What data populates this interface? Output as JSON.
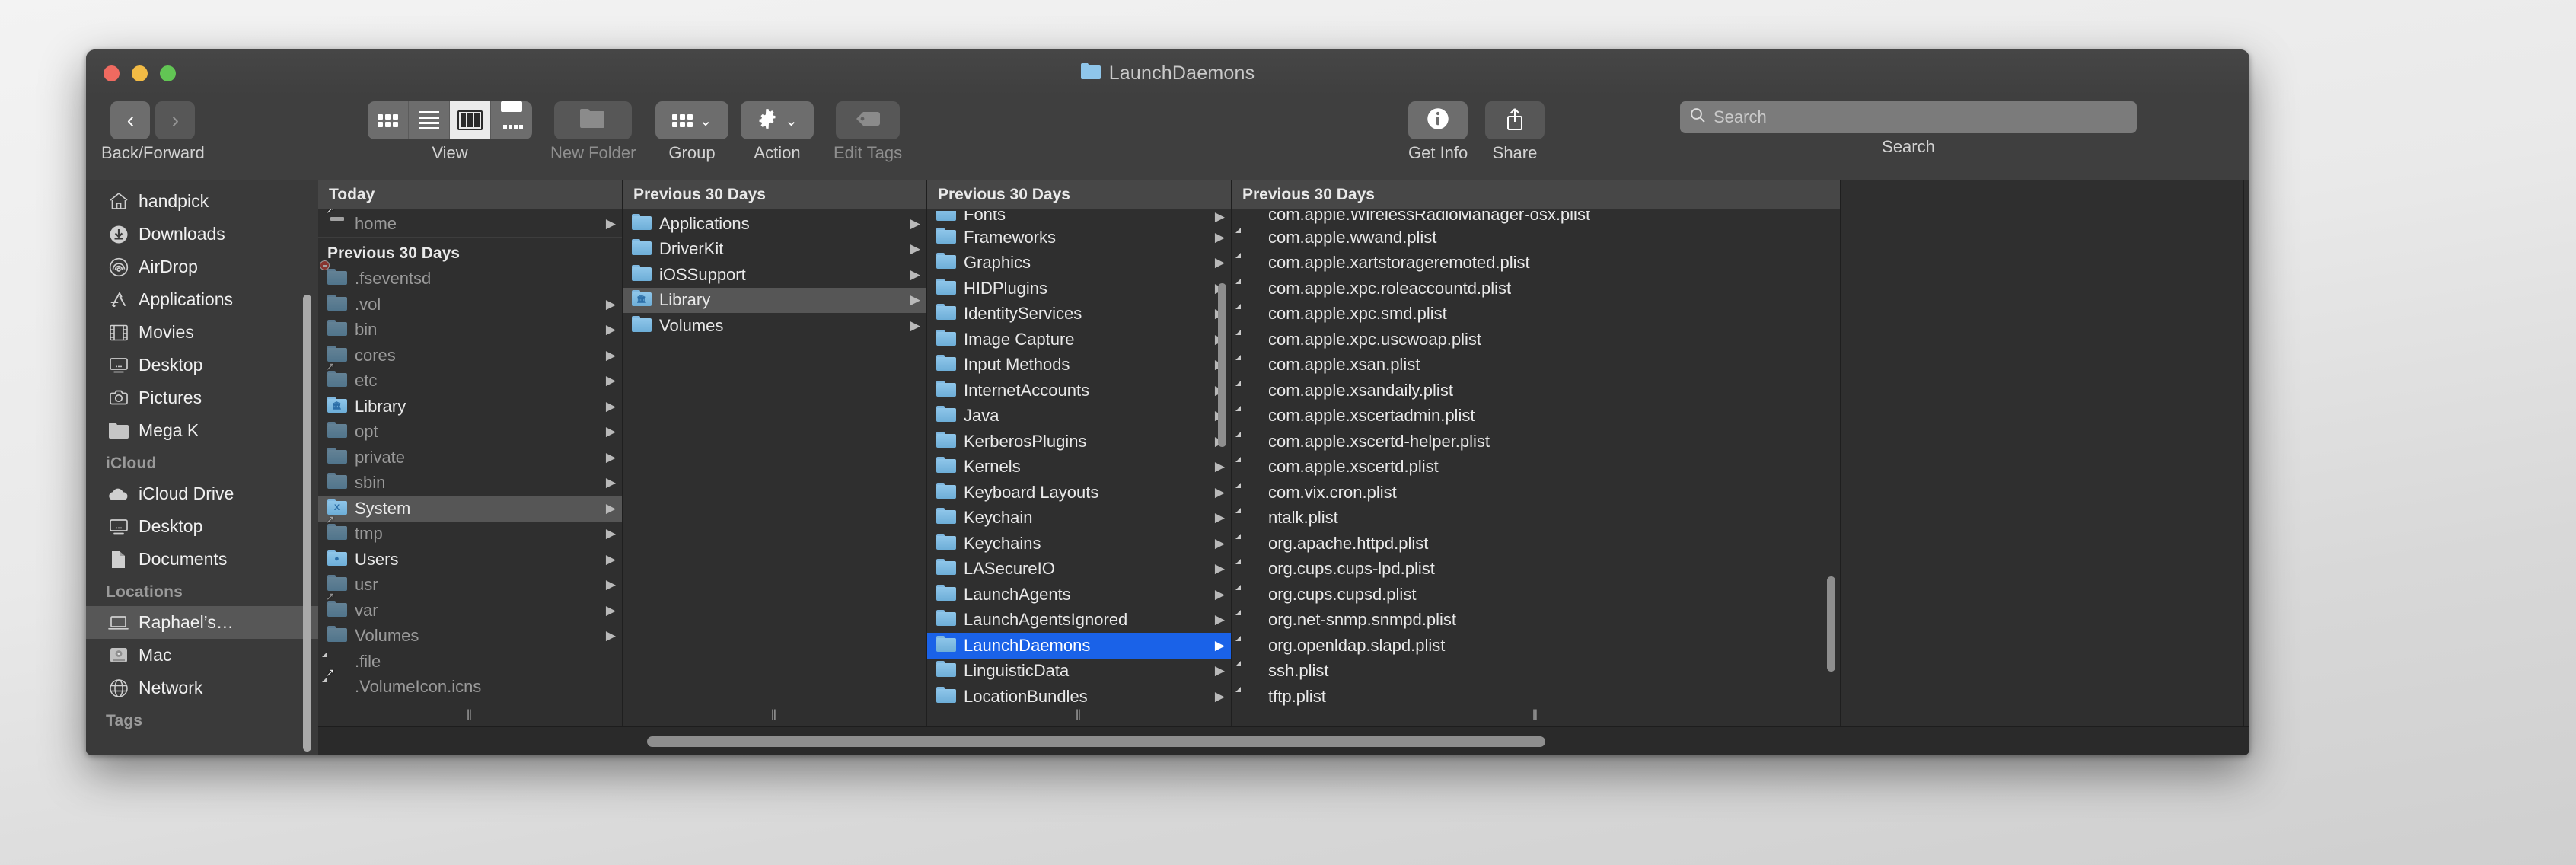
{
  "window": {
    "title": "LaunchDaemons",
    "traffic_lights": [
      "close",
      "minimize",
      "zoom"
    ]
  },
  "toolbar": {
    "nav": {
      "label": "Back/Forward",
      "back": "‹",
      "forward": "›"
    },
    "view": {
      "label": "View",
      "options": [
        "icon",
        "list",
        "column",
        "gallery"
      ],
      "selected": "column"
    },
    "new_folder": {
      "label": "New Folder"
    },
    "group": {
      "label": "Group"
    },
    "action": {
      "label": "Action"
    },
    "edit_tags": {
      "label": "Edit Tags"
    },
    "get_info": {
      "label": "Get Info"
    },
    "share": {
      "label": "Share"
    },
    "search": {
      "label": "Search",
      "placeholder": "Search",
      "value": ""
    }
  },
  "sidebar": {
    "sections": [
      {
        "heading": "",
        "items": [
          {
            "label": "handpick",
            "icon": "home-icon"
          },
          {
            "label": "Downloads",
            "icon": "downloads-icon"
          },
          {
            "label": "AirDrop",
            "icon": "airdrop-icon"
          },
          {
            "label": "Applications",
            "icon": "applications-icon"
          },
          {
            "label": "Movies",
            "icon": "movies-icon"
          },
          {
            "label": "Desktop",
            "icon": "desktop-icon"
          },
          {
            "label": "Pictures",
            "icon": "pictures-icon"
          },
          {
            "label": "Mega K",
            "icon": "folder-icon"
          }
        ]
      },
      {
        "heading": "iCloud",
        "items": [
          {
            "label": "iCloud Drive",
            "icon": "cloud-icon"
          },
          {
            "label": "Desktop",
            "icon": "desktop-icon"
          },
          {
            "label": "Documents",
            "icon": "documents-icon"
          }
        ]
      },
      {
        "heading": "Locations",
        "items": [
          {
            "label": "Raphael’s…",
            "icon": "laptop-icon",
            "selected": true
          },
          {
            "label": "Mac",
            "icon": "harddisk-icon"
          },
          {
            "label": "Network",
            "icon": "network-icon"
          }
        ]
      },
      {
        "heading": "Tags",
        "items": []
      }
    ]
  },
  "columns": [
    {
      "header": "Today",
      "groups": [
        {
          "label": "",
          "rows": [
            {
              "name": "home",
              "icon": "network-drive-icon",
              "arrow": true,
              "dim": true,
              "alias": true
            }
          ]
        },
        {
          "label": "Previous 30 Days",
          "rows": [
            {
              "name": ".fseventsd",
              "icon": "folder-icon",
              "arrow": false,
              "dim": true,
              "stop": true
            },
            {
              "name": ".vol",
              "icon": "folder-icon",
              "arrow": true,
              "dim": true
            },
            {
              "name": "bin",
              "icon": "folder-icon",
              "arrow": true,
              "dim": true
            },
            {
              "name": "cores",
              "icon": "folder-icon",
              "arrow": true,
              "dim": true
            },
            {
              "name": "etc",
              "icon": "folder-icon",
              "arrow": true,
              "dim": true,
              "alias": true
            },
            {
              "name": "Library",
              "icon": "library-folder-icon",
              "arrow": true,
              "dim": false
            },
            {
              "name": "opt",
              "icon": "folder-icon",
              "arrow": true,
              "dim": true
            },
            {
              "name": "private",
              "icon": "folder-icon",
              "arrow": true,
              "dim": true
            },
            {
              "name": "sbin",
              "icon": "folder-icon",
              "arrow": true,
              "dim": true
            },
            {
              "name": "System",
              "icon": "system-folder-icon",
              "arrow": true,
              "dim": false,
              "selected": "inactive"
            },
            {
              "name": "tmp",
              "icon": "folder-icon",
              "arrow": true,
              "dim": true,
              "alias": true
            },
            {
              "name": "Users",
              "icon": "users-folder-icon",
              "arrow": true,
              "dim": false
            },
            {
              "name": "usr",
              "icon": "folder-icon",
              "arrow": true,
              "dim": true
            },
            {
              "name": "var",
              "icon": "folder-icon",
              "arrow": true,
              "dim": true,
              "alias": true
            },
            {
              "name": "Volumes",
              "icon": "folder-icon",
              "arrow": true,
              "dim": true
            },
            {
              "name": ".file",
              "icon": "document-icon",
              "arrow": false,
              "dim": true
            },
            {
              "name": ".VolumeIcon.icns",
              "icon": "document-icon",
              "arrow": false,
              "dim": true,
              "alias": true
            }
          ]
        }
      ]
    },
    {
      "header": "Previous 30 Days",
      "groups": [
        {
          "label": "",
          "rows": [
            {
              "name": "Applications",
              "icon": "folder-icon",
              "arrow": true
            },
            {
              "name": "DriverKit",
              "icon": "folder-icon",
              "arrow": true
            },
            {
              "name": "iOSSupport",
              "icon": "folder-icon",
              "arrow": true
            },
            {
              "name": "Library",
              "icon": "library-folder-icon",
              "arrow": true,
              "selected": "inactive"
            },
            {
              "name": "Volumes",
              "icon": "folder-icon",
              "arrow": true
            }
          ]
        }
      ]
    },
    {
      "header": "Previous 30 Days",
      "groups": [
        {
          "label": "",
          "rows": [
            {
              "name": "Fonts",
              "icon": "folder-icon",
              "arrow": true,
              "clipped": true
            },
            {
              "name": "Frameworks",
              "icon": "folder-icon",
              "arrow": true
            },
            {
              "name": "Graphics",
              "icon": "folder-icon",
              "arrow": true
            },
            {
              "name": "HIDPlugins",
              "icon": "folder-icon",
              "arrow": true
            },
            {
              "name": "IdentityServices",
              "icon": "folder-icon",
              "arrow": true
            },
            {
              "name": "Image Capture",
              "icon": "folder-icon",
              "arrow": true
            },
            {
              "name": "Input Methods",
              "icon": "folder-icon",
              "arrow": true
            },
            {
              "name": "InternetAccounts",
              "icon": "folder-icon",
              "arrow": true
            },
            {
              "name": "Java",
              "icon": "folder-icon",
              "arrow": true
            },
            {
              "name": "KerberosPlugins",
              "icon": "folder-icon",
              "arrow": true
            },
            {
              "name": "Kernels",
              "icon": "folder-icon",
              "arrow": true
            },
            {
              "name": "Keyboard Layouts",
              "icon": "folder-icon",
              "arrow": true
            },
            {
              "name": "Keychain",
              "icon": "folder-icon",
              "arrow": true
            },
            {
              "name": "Keychains",
              "icon": "folder-icon",
              "arrow": true
            },
            {
              "name": "LASecureIO",
              "icon": "folder-icon",
              "arrow": true
            },
            {
              "name": "LaunchAgents",
              "icon": "folder-icon",
              "arrow": true
            },
            {
              "name": "LaunchAgentsIgnored",
              "icon": "folder-icon",
              "arrow": true
            },
            {
              "name": "LaunchDaemons",
              "icon": "folder-icon",
              "arrow": true,
              "selected": "active"
            },
            {
              "name": "LinguisticData",
              "icon": "folder-icon",
              "arrow": true
            },
            {
              "name": "LocationBundles",
              "icon": "folder-icon",
              "arrow": true
            }
          ]
        }
      ]
    },
    {
      "header": "Previous 30 Days",
      "groups": [
        {
          "label": "",
          "rows": [
            {
              "name": "com.apple.WirelessRadioManager-osx.plist",
              "icon": "document-icon",
              "clipped": true
            },
            {
              "name": "com.apple.wwand.plist",
              "icon": "document-icon"
            },
            {
              "name": "com.apple.xartstorageremoted.plist",
              "icon": "document-icon"
            },
            {
              "name": "com.apple.xpc.roleaccountd.plist",
              "icon": "document-icon"
            },
            {
              "name": "com.apple.xpc.smd.plist",
              "icon": "document-icon"
            },
            {
              "name": "com.apple.xpc.uscwoap.plist",
              "icon": "document-icon"
            },
            {
              "name": "com.apple.xsan.plist",
              "icon": "document-icon"
            },
            {
              "name": "com.apple.xsandaily.plist",
              "icon": "document-icon"
            },
            {
              "name": "com.apple.xscertadmin.plist",
              "icon": "document-icon"
            },
            {
              "name": "com.apple.xscertd-helper.plist",
              "icon": "document-icon"
            },
            {
              "name": "com.apple.xscertd.plist",
              "icon": "document-icon"
            },
            {
              "name": "com.vix.cron.plist",
              "icon": "document-icon"
            },
            {
              "name": "ntalk.plist",
              "icon": "document-icon"
            },
            {
              "name": "org.apache.httpd.plist",
              "icon": "document-icon"
            },
            {
              "name": "org.cups.cups-lpd.plist",
              "icon": "document-icon"
            },
            {
              "name": "org.cups.cupsd.plist",
              "icon": "document-icon"
            },
            {
              "name": "org.net-snmp.snmpd.plist",
              "icon": "document-icon"
            },
            {
              "name": "org.openldap.slapd.plist",
              "icon": "document-icon"
            },
            {
              "name": "ssh.plist",
              "icon": "document-icon"
            },
            {
              "name": "tftp.plist",
              "icon": "document-icon"
            }
          ]
        }
      ]
    },
    {
      "header": "",
      "groups": [
        {
          "label": "",
          "rows": []
        }
      ]
    }
  ],
  "colors": {
    "accent_selection": "#1a62e8",
    "inactive_selection": "#565656",
    "window_bg": "#2f2f2f",
    "toolbar_bg": "#3f3f3f",
    "sidebar_bg": "#3a3a3a",
    "folder_blue": "#8fc6ea"
  }
}
